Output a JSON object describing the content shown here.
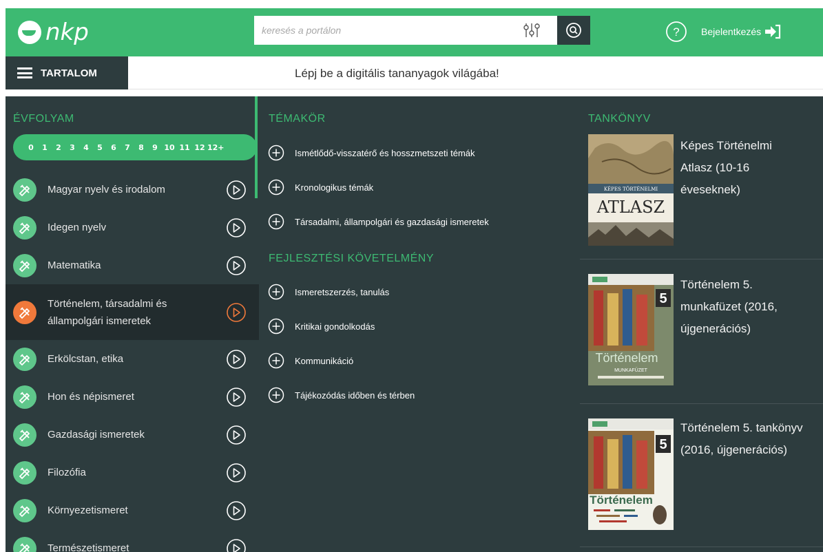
{
  "header": {
    "logo_text": "nkp",
    "search_placeholder": "keresés a portálon",
    "login_label": "Bejelentkezés",
    "help": "?",
    "accent_color": "#3dba72"
  },
  "subbar": {
    "menu_label": "TARTALOM",
    "tagline": "Lépj be a digitális tananyagok világába!"
  },
  "left": {
    "title": "ÉVFOLYAM",
    "grades": [
      "0",
      "1",
      "2",
      "3",
      "4",
      "5",
      "6",
      "7",
      "8",
      "9",
      "10",
      "11",
      "12",
      "12+"
    ],
    "subjects": [
      {
        "label": "Magyar nyelv és irodalom",
        "active": false
      },
      {
        "label": "Idegen nyelv",
        "active": false
      },
      {
        "label": "Matematika",
        "active": false
      },
      {
        "label": "Történelem, társadalmi és állampolgári ismeretek",
        "active": true
      },
      {
        "label": "Erkölcstan, etika",
        "active": false
      },
      {
        "label": "Hon és népismeret",
        "active": false
      },
      {
        "label": "Gazdasági ismeretek",
        "active": false
      },
      {
        "label": "Filozófia",
        "active": false
      },
      {
        "label": "Környezetismeret",
        "active": false
      },
      {
        "label": "Természetismeret",
        "active": false
      }
    ]
  },
  "middle": {
    "title1": "TÉMAKÖR",
    "topics1": [
      "Ismétlődő-visszatérő és hosszmetszeti témák",
      "Kronologikus témák",
      "Társadalmi, állampolgári és gazdasági ismeretek"
    ],
    "title2": "FEJLESZTÉSI KÖVETELMÉNY",
    "topics2": [
      "Ismeretszerzés, tanulás",
      "Kritikai gondolkodás",
      "Kommunikáció",
      "Tájékozódás időben és térben"
    ]
  },
  "right": {
    "title": "TANKÖNYV",
    "books": [
      {
        "title_lines": [
          "Képes Történelmi",
          "Atlasz (10-16",
          "éveseknek)"
        ],
        "cover_top": "KÉPES TÖRTÉNELMI",
        "cover_main": "ATLASZ"
      },
      {
        "title_lines": [
          "Történelem 5.",
          "munkafüzet (2016,",
          "újgenerációs)"
        ],
        "cover_num": "5",
        "cover_word": "Történelem",
        "cover_sub": "MUNKAFÜZET"
      },
      {
        "title_lines": [
          "Történelem 5. tankönyv",
          "(2016, újgenerációs)"
        ],
        "cover_num": "5",
        "cover_word": "Történelem"
      }
    ]
  }
}
